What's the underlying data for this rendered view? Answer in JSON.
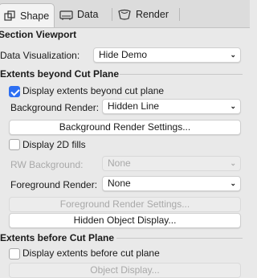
{
  "tabs": [
    {
      "label": "Shape",
      "icon": "shape-icon",
      "active": true
    },
    {
      "label": "Data",
      "icon": "data-icon",
      "active": false
    },
    {
      "label": "Render",
      "icon": "render-icon",
      "active": false
    }
  ],
  "section_viewport": {
    "title": "Section Viewport"
  },
  "data_visualization": {
    "label": "Data Visualization:",
    "value": "Hide Demo"
  },
  "beyond": {
    "title": "Extents beyond Cut Plane",
    "display_extents": {
      "label": "Display extents beyond cut plane",
      "checked": true
    },
    "background_render": {
      "label": "Background Render:",
      "value": "Hidden Line"
    },
    "background_settings_button": "Background Render Settings...",
    "display_2d_fills": {
      "label": "Display 2D fills",
      "checked": false
    },
    "rw_background": {
      "label": "RW Background:",
      "value": "None"
    },
    "foreground_render": {
      "label": "Foreground Render:",
      "value": "None"
    },
    "foreground_settings_button": "Foreground Render Settings...",
    "hidden_object_button": "Hidden Object Display..."
  },
  "before": {
    "title": "Extents before Cut Plane",
    "display_extents": {
      "label": "Display extents before cut plane",
      "checked": false
    },
    "object_display_button": "Object Display..."
  }
}
